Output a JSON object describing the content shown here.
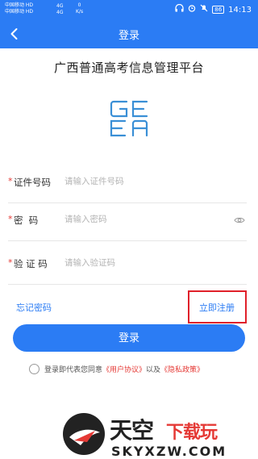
{
  "statusbar": {
    "carrier1": "中国移动 HD",
    "carrier2": "中国移动 HD",
    "signal1": "4G",
    "signal2": "4G",
    "speed_value": "0",
    "speed_unit": "K/s",
    "battery": "86",
    "time": "14:13"
  },
  "navbar": {
    "title": "登录"
  },
  "app": {
    "title": "广西普通高考信息管理平台",
    "logo_text": "GEEA"
  },
  "form": {
    "id_label": "证件号码",
    "id_placeholder": "请输入证件号码",
    "password_label": "密  码",
    "password_placeholder": "请输入密码",
    "captcha_label": "验 证 码",
    "captcha_placeholder": "请输入验证码",
    "required_mark": "*"
  },
  "links": {
    "forgot": "忘记密码",
    "register": "立即注册"
  },
  "login_button": "登录",
  "agreement": {
    "prefix": "登录即代表您同意",
    "user_agreement": "《用户协议》",
    "middle": "以及",
    "privacy": "《隐私政策》"
  },
  "watermark": {
    "text1": "天空",
    "text2": "下载玩",
    "url": "SKYXZW.COM"
  },
  "colors": {
    "primary": "#2b7cf4",
    "required": "#e53935",
    "highlight_box": "#e0202a"
  }
}
